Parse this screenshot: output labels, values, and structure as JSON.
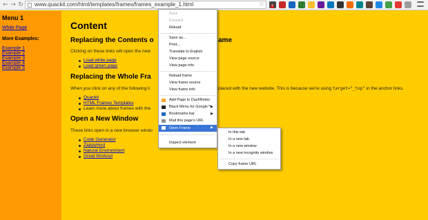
{
  "browser": {
    "url": "www.quackit.com/html/templates/frames/frames_example_1.html",
    "extension_badge": "7"
  },
  "left_frame": {
    "menu_title": "Menu 1",
    "white_page": "White Page",
    "more_title": "More Examples:",
    "examples": [
      "Example 1",
      "Example 2",
      "Example 3",
      "Example 4",
      "Example 5"
    ]
  },
  "content": {
    "title": "Content",
    "section1": {
      "heading_start": "Replacing the Contents o",
      "heading_end": "ame",
      "text": "Clicking on these links will open the new",
      "links": [
        "Load white page",
        "Load green page"
      ]
    },
    "section2": {
      "heading": "Replacing the Whole Fra",
      "text_start": "When you click on any of the following li",
      "text_end_prefix": "placed with the new website. This is because we're using",
      "text_code": "target=\"_top\"",
      "text_end_suffix": "in the anchor links.",
      "links": [
        "Quackit",
        "HTML Frames Templates"
      ],
      "plain_item": "Learn more about frames with the"
    },
    "section3": {
      "heading": "Open a New Window",
      "text": "These links open in a new browser windo",
      "links": [
        "Code Generator",
        "ZappyHost",
        "Natural Environment",
        "Great Workout"
      ]
    }
  },
  "context_menu": {
    "back": "Back",
    "forward": "Forward",
    "reload": "Reload",
    "save_as": "Save as...",
    "print": "Print...",
    "translate": "Translate to English",
    "view_source": "View page source",
    "view_info": "View page info",
    "reload_frame": "Reload frame",
    "view_frame_source": "View frame source",
    "view_frame_info": "View frame info",
    "add_dashnotes": "Add Page to DashNotes",
    "black_menu": "Black Menu for Google™",
    "bookmarks_bar": "Bookmarks bar",
    "mail_url": "Mail this page's URL",
    "open_frame": "Open Frame",
    "inspect": "Inspect element"
  },
  "submenu": {
    "this_tab": "In this tab",
    "new_tab": "In a new tab",
    "new_window": "In a new window",
    "incognito": "In a new incognito window",
    "copy_url": "Copy frame URL"
  },
  "colors": {
    "left_frame_bg": "#ff9900",
    "main_bg": "#ffcc00",
    "menu_highlight": "#3875d7",
    "link": "#0000cc"
  },
  "icons": {
    "back": "←",
    "forward": "→",
    "reload": "↻",
    "star": "☆",
    "submenu_arrow": "▶"
  }
}
